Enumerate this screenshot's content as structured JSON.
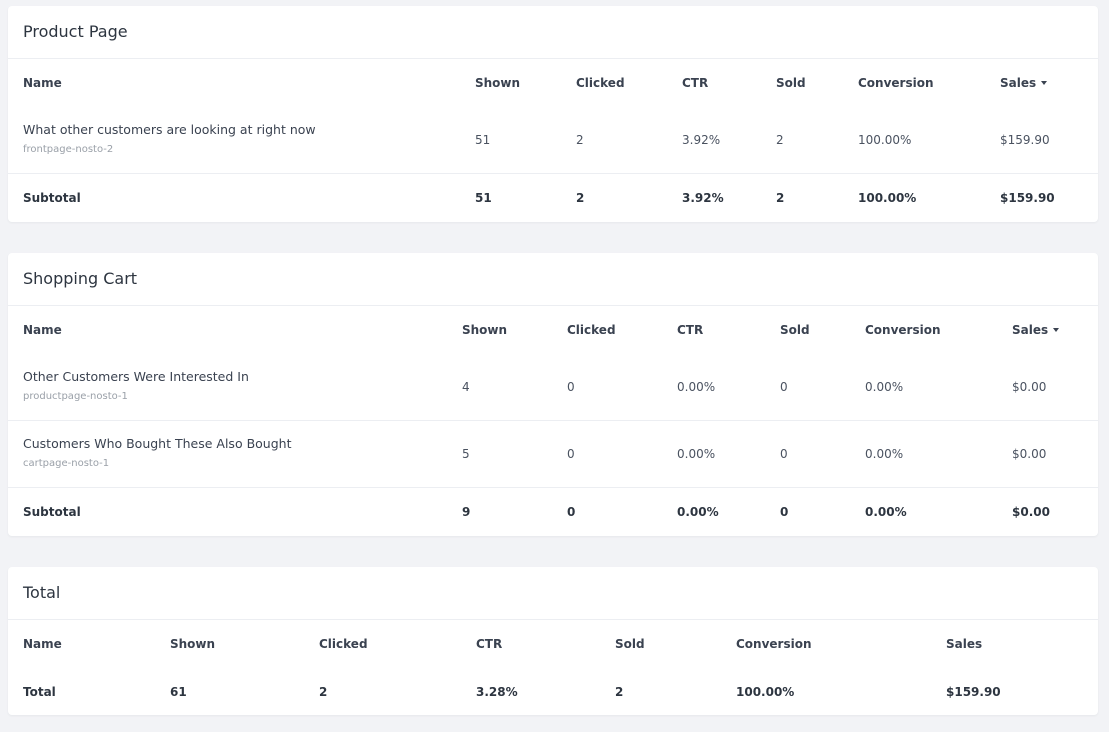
{
  "product_page": {
    "title": "Product Page",
    "headers": {
      "name": "Name",
      "shown": "Shown",
      "clicked": "Clicked",
      "ctr": "CTR",
      "sold": "Sold",
      "conversion": "Conversion",
      "sales": "Sales"
    },
    "rows": [
      {
        "name": "What other customers are looking at right now",
        "id": "frontpage-nosto-2",
        "shown": "51",
        "clicked": "2",
        "ctr": "3.92%",
        "sold": "2",
        "conversion": "100.00%",
        "sales": "$159.90"
      }
    ],
    "subtotal": {
      "label": "Subtotal",
      "shown": "51",
      "clicked": "2",
      "ctr": "3.92%",
      "sold": "2",
      "conversion": "100.00%",
      "sales": "$159.90"
    }
  },
  "shopping_cart": {
    "title": "Shopping Cart",
    "headers": {
      "name": "Name",
      "shown": "Shown",
      "clicked": "Clicked",
      "ctr": "CTR",
      "sold": "Sold",
      "conversion": "Conversion",
      "sales": "Sales"
    },
    "rows": [
      {
        "name": "Other Customers Were Interested In",
        "id": "productpage-nosto-1",
        "shown": "4",
        "clicked": "0",
        "ctr": "0.00%",
        "sold": "0",
        "conversion": "0.00%",
        "sales": "$0.00"
      },
      {
        "name": "Customers Who Bought These Also Bought",
        "id": "cartpage-nosto-1",
        "shown": "5",
        "clicked": "0",
        "ctr": "0.00%",
        "sold": "0",
        "conversion": "0.00%",
        "sales": "$0.00"
      }
    ],
    "subtotal": {
      "label": "Subtotal",
      "shown": "9",
      "clicked": "0",
      "ctr": "0.00%",
      "sold": "0",
      "conversion": "0.00%",
      "sales": "$0.00"
    }
  },
  "total": {
    "title": "Total",
    "headers": {
      "name": "Name",
      "shown": "Shown",
      "clicked": "Clicked",
      "ctr": "CTR",
      "sold": "Sold",
      "conversion": "Conversion",
      "sales": "Sales"
    },
    "row": {
      "label": "Total",
      "shown": "61",
      "clicked": "2",
      "ctr": "3.28%",
      "sold": "2",
      "conversion": "100.00%",
      "sales": "$159.90"
    }
  }
}
